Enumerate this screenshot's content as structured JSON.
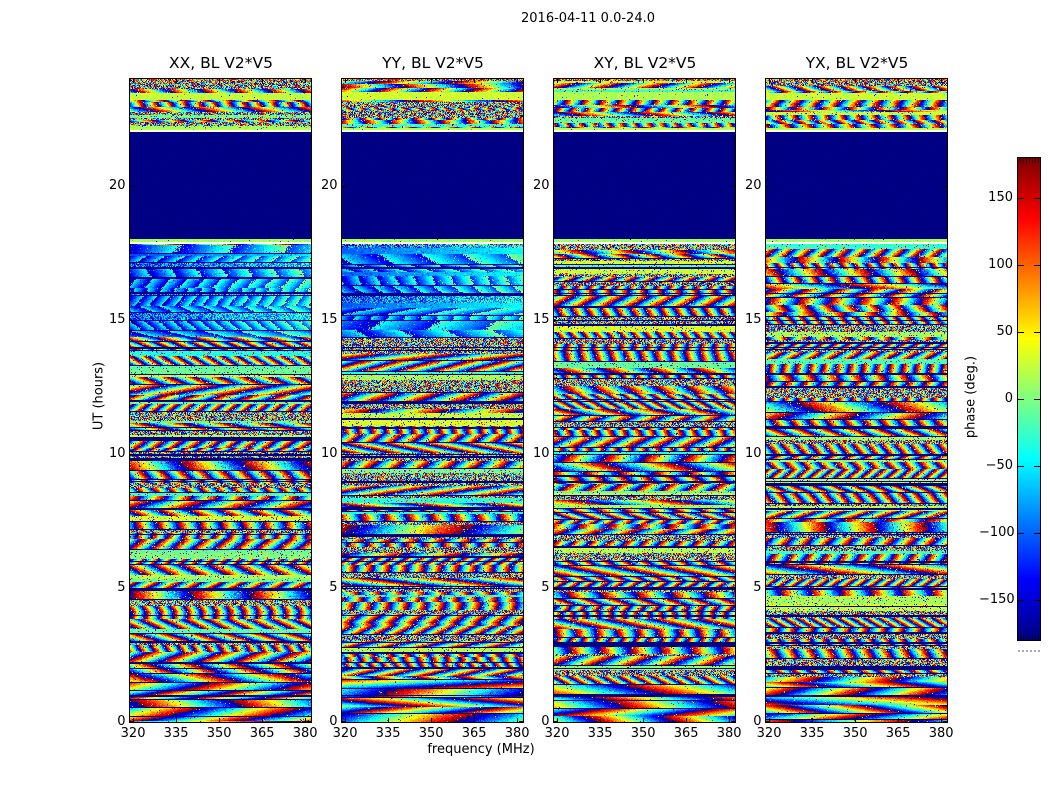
{
  "chart_data": {
    "type": "heatmap",
    "title": "2016-04-11 0.0-24.0",
    "xlabel": "frequency (MHz)",
    "ylabel": "UT (hours)",
    "panels": [
      {
        "pol": "XX",
        "title": "XX, BL V2*V5"
      },
      {
        "pol": "YY",
        "title": "YY, BL V2*V5"
      },
      {
        "pol": "XY",
        "title": "XY, BL V2*V5"
      },
      {
        "pol": "YX",
        "title": "YX, BL V2*V5"
      }
    ],
    "x_ticks": [
      320,
      335,
      350,
      365,
      380
    ],
    "x_tick_labels": [
      "320",
      "335",
      "350",
      "365",
      "380"
    ],
    "x_range_mhz": [
      319.1,
      382.2
    ],
    "y_ticks": [
      0,
      5,
      10,
      15,
      20
    ],
    "y_tick_labels": [
      "0",
      "5",
      "10",
      "15",
      "20"
    ],
    "y_range_hours": [
      0,
      24
    ],
    "colorbar": {
      "label": "phase (deg.)",
      "ticks": [
        150,
        100,
        50,
        0,
        -50,
        -100,
        -150
      ],
      "tick_labels": [
        "150",
        "100",
        "50",
        "0",
        "−50",
        "−100",
        "−150"
      ],
      "vmin": -180,
      "vmax": 180,
      "colormap": "jet"
    },
    "features": {
      "flagged_gap_ut": [
        18.0,
        22.0
      ],
      "calm_green_band_ut": [
        23.3,
        23.6
      ],
      "hourly_flag_lines": true,
      "content": "visibility phase vs frequency and time; noisy wrapped-phase fringes, solid flagged block between UT 18 and 22"
    }
  }
}
